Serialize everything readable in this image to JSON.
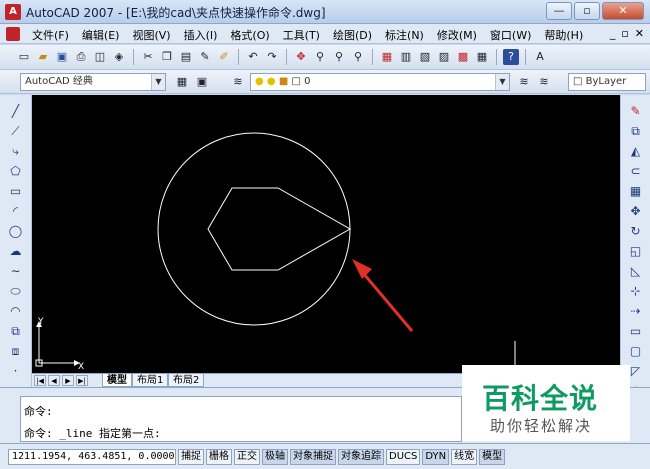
{
  "window": {
    "title": "AutoCAD 2007 - [E:\\我的cad\\夹点快速操作命令.dwg]",
    "minimize": "—",
    "restore": "▫",
    "close": "✕"
  },
  "menu": {
    "items": [
      "文件(F)",
      "编辑(E)",
      "视图(V)",
      "插入(I)",
      "格式(O)",
      "工具(T)",
      "绘图(D)",
      "标注(N)",
      "修改(M)",
      "窗口(W)",
      "帮助(H)"
    ],
    "doc_min": "_",
    "doc_restore": "▫",
    "doc_close": "✕"
  },
  "toolbar2": {
    "workspace": "AutoCAD 经典",
    "layer": "0",
    "linetype": "ByLayer"
  },
  "layout_tabs": [
    "模型",
    "布局1",
    "布局2"
  ],
  "command": {
    "line1": "命令:",
    "line2": "命令: _line 指定第一点:"
  },
  "status": {
    "coords": "1211.1954, 463.4851, 0.0000",
    "toggles": [
      "捕捉",
      "栅格",
      "正交",
      "极轴",
      "对象捕捉",
      "对象追踪",
      "DUCS",
      "DYN",
      "线宽",
      "模型"
    ]
  },
  "watermark": {
    "title": "百科全说",
    "subtitle": "助你轻松解决"
  },
  "ucs": {
    "x": "X",
    "y": "Y"
  },
  "colors": {
    "canvas": "#000000",
    "geometry": "#ffffff",
    "arrow": "#e0302a",
    "watermark": "#0f9a63"
  }
}
